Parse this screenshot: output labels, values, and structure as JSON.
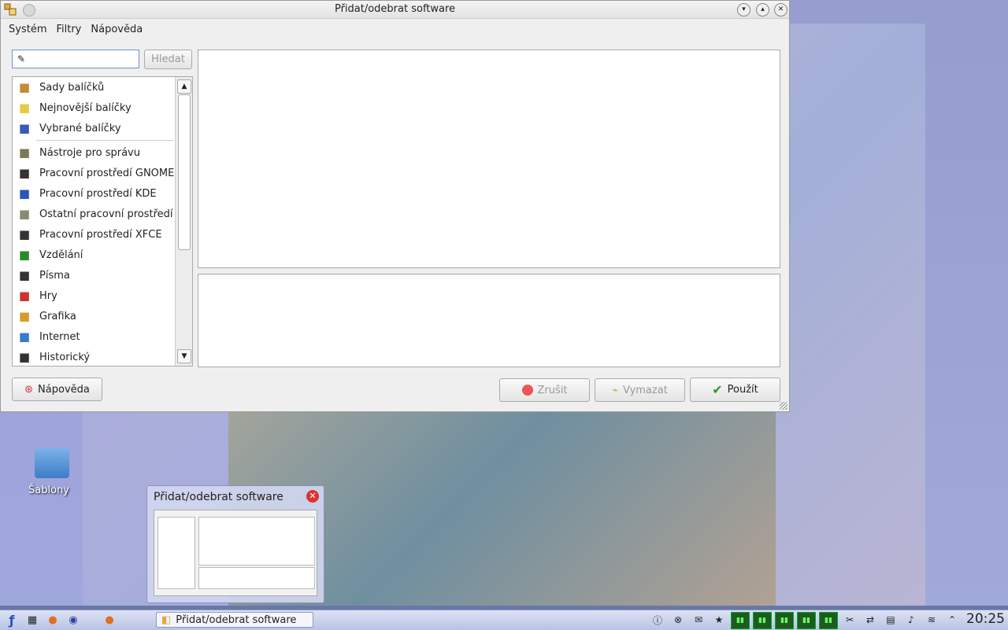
{
  "window": {
    "title": "Přidat/odebrat software",
    "menu": [
      "Systém",
      "Filtry",
      "Nápověda"
    ],
    "search": {
      "value": "",
      "button": "Hledat"
    },
    "categories_top": [
      {
        "label": "Sady balíčků",
        "icon": "package-icon"
      },
      {
        "label": "Nejnovější balíčky",
        "icon": "lightbulb-icon"
      },
      {
        "label": "Vybrané balíčky",
        "icon": "magnifier-icon"
      }
    ],
    "categories": [
      {
        "label": "Nástroje pro správu",
        "icon": "admin-tools-icon"
      },
      {
        "label": "Pracovní prostředí GNOME",
        "icon": "gnome-icon"
      },
      {
        "label": "Pracovní prostředí KDE",
        "icon": "kde-icon"
      },
      {
        "label": "Ostatní pracovní prostředí",
        "icon": "desktop-icon"
      },
      {
        "label": "Pracovní prostředí XFCE",
        "icon": "xfce-icon"
      },
      {
        "label": "Vzdělání",
        "icon": "education-icon"
      },
      {
        "label": "Písma",
        "icon": "fonts-icon"
      },
      {
        "label": "Hry",
        "icon": "games-icon"
      },
      {
        "label": "Grafika",
        "icon": "graphics-icon"
      },
      {
        "label": "Internet",
        "icon": "internet-icon"
      },
      {
        "label": "Historický",
        "icon": "floppy-icon"
      }
    ],
    "buttons": {
      "help": "Nápověda",
      "cancel": "Zrušit",
      "clear": "Vymazat",
      "apply": "Použít"
    }
  },
  "popup": {
    "title": "Přidat/odebrat software"
  },
  "desktop": {
    "folder_label": "Šablony"
  },
  "taskbar": {
    "task_label": "Přidat/odebrat software",
    "clock": "20:25"
  }
}
